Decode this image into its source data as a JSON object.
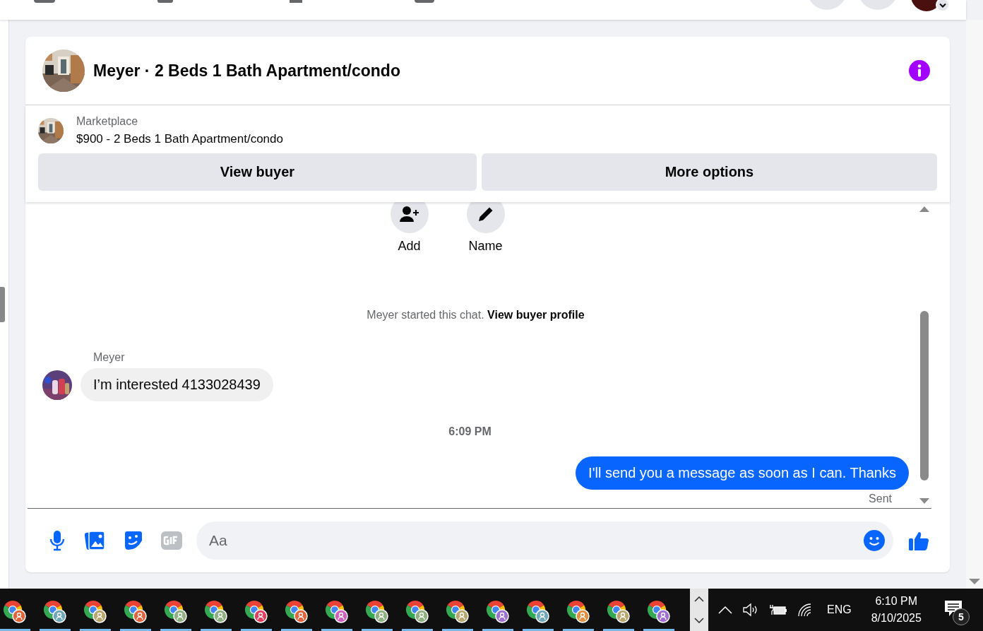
{
  "listing_header": {
    "title": "Meyer · 2 Beds 1 Bath Apartment/condo"
  },
  "listing": {
    "source": "Marketplace",
    "summary": "$900 - 2 Beds 1 Bath Apartment/condo",
    "buttons": [
      "View buyer",
      "More options"
    ]
  },
  "actions": [
    {
      "kind": "add",
      "label": "Add"
    },
    {
      "kind": "name",
      "label": "Name"
    }
  ],
  "messages": [
    {
      "kind": "notice",
      "text": "Meyer started this chat. ",
      "link": "View buyer profile"
    },
    {
      "kind": "sender",
      "text": "Meyer"
    },
    {
      "kind": "incoming",
      "text": "I’m interested 4133028439"
    },
    {
      "kind": "time",
      "text": "6:09 PM"
    },
    {
      "kind": "outgoing",
      "text": "I'll send you a message as soon as I can. Thanks"
    },
    {
      "kind": "status",
      "text": "Sent"
    }
  ],
  "composer": {
    "placeholder": "Aa"
  },
  "taskbar": {
    "apps": [
      {
        "color": "#e0643c"
      },
      {
        "color": "#6fa8b8"
      },
      {
        "color": "#b8a870"
      },
      {
        "color": "#e0643c"
      },
      {
        "color": "#8fb080"
      },
      {
        "color": "#8fb080"
      },
      {
        "color": "#e04060"
      },
      {
        "color": "#e0643c"
      },
      {
        "color": "#d060c0"
      },
      {
        "color": "#8fb080"
      },
      {
        "color": "#8fb080"
      },
      {
        "color": "#b8a870"
      },
      {
        "color": "#a070d0"
      },
      {
        "color": "#6fa8b8"
      },
      {
        "color": "#e09040"
      },
      {
        "color": "#b8a870"
      },
      {
        "color": "#a070d0"
      }
    ],
    "language": "ENG",
    "time": "6:10 PM",
    "date": "8/10/2025",
    "notifications": "5"
  }
}
